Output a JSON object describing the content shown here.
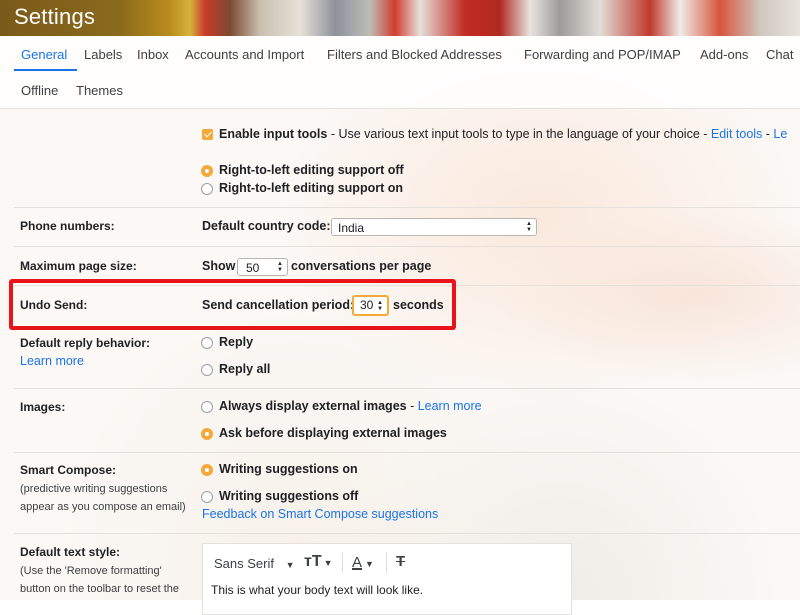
{
  "header": {
    "title": "Settings"
  },
  "tabs": [
    "General",
    "Labels",
    "Inbox",
    "Accounts and Import",
    "Filters and Blocked Addresses",
    "Forwarding and POP/IMAP",
    "Add-ons",
    "Chat",
    "Offline",
    "Themes"
  ],
  "input_tools": {
    "label": "Enable input tools",
    "description": " - Use various text input tools to type in the language of your choice - ",
    "edit_link": "Edit tools",
    "trailing_link": "Le"
  },
  "rtl": {
    "off": "Right-to-left editing support off",
    "on": "Right-to-left editing support on"
  },
  "phone_numbers": {
    "label": "Phone numbers:",
    "field_label": "Default country code:",
    "value": "India"
  },
  "page_size": {
    "label": "Maximum page size:",
    "prefix": "Show",
    "value": "50",
    "suffix": "conversations per page"
  },
  "undo_send": {
    "label": "Undo Send:",
    "field_label": "Send cancellation period:",
    "value": "30",
    "suffix": "seconds"
  },
  "reply_behavior": {
    "label": "Default reply behavior:",
    "learn_more": "Learn more",
    "reply": "Reply",
    "reply_all": "Reply all"
  },
  "images": {
    "label": "Images:",
    "always": "Always display external images",
    "always_link": "Learn more",
    "always_sep": " - ",
    "ask": "Ask before displaying external images"
  },
  "smart_compose": {
    "label": "Smart Compose:",
    "sublabel": "(predictive writing suggestions appear as you compose an email)",
    "on": "Writing suggestions on",
    "off": "Writing suggestions off",
    "feedback": "Feedback on Smart Compose suggestions"
  },
  "text_style": {
    "label": "Default text style:",
    "sublabel": "(Use the 'Remove formatting' button on the toolbar to reset the",
    "font": "Sans Serif",
    "preview": "This is what your body text will look like."
  },
  "colors": {
    "accent": "#f4a93b",
    "link": "#1a73e8",
    "highlight": "#e8141b"
  }
}
